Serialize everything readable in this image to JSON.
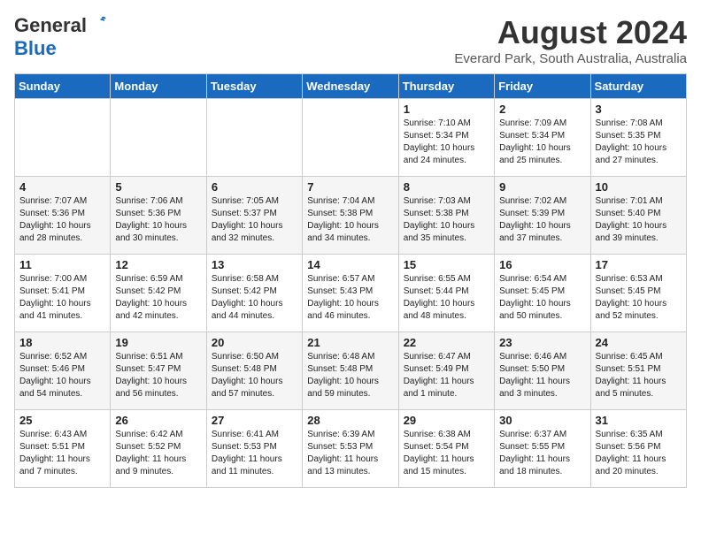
{
  "logo": {
    "general": "General",
    "blue": "Blue"
  },
  "title": "August 2024",
  "subtitle": "Everard Park, South Australia, Australia",
  "days_of_week": [
    "Sunday",
    "Monday",
    "Tuesday",
    "Wednesday",
    "Thursday",
    "Friday",
    "Saturday"
  ],
  "weeks": [
    [
      {
        "day": "",
        "info": ""
      },
      {
        "day": "",
        "info": ""
      },
      {
        "day": "",
        "info": ""
      },
      {
        "day": "",
        "info": ""
      },
      {
        "day": "1",
        "info": "Sunrise: 7:10 AM\nSunset: 5:34 PM\nDaylight: 10 hours\nand 24 minutes."
      },
      {
        "day": "2",
        "info": "Sunrise: 7:09 AM\nSunset: 5:34 PM\nDaylight: 10 hours\nand 25 minutes."
      },
      {
        "day": "3",
        "info": "Sunrise: 7:08 AM\nSunset: 5:35 PM\nDaylight: 10 hours\nand 27 minutes."
      }
    ],
    [
      {
        "day": "4",
        "info": "Sunrise: 7:07 AM\nSunset: 5:36 PM\nDaylight: 10 hours\nand 28 minutes."
      },
      {
        "day": "5",
        "info": "Sunrise: 7:06 AM\nSunset: 5:36 PM\nDaylight: 10 hours\nand 30 minutes."
      },
      {
        "day": "6",
        "info": "Sunrise: 7:05 AM\nSunset: 5:37 PM\nDaylight: 10 hours\nand 32 minutes."
      },
      {
        "day": "7",
        "info": "Sunrise: 7:04 AM\nSunset: 5:38 PM\nDaylight: 10 hours\nand 34 minutes."
      },
      {
        "day": "8",
        "info": "Sunrise: 7:03 AM\nSunset: 5:38 PM\nDaylight: 10 hours\nand 35 minutes."
      },
      {
        "day": "9",
        "info": "Sunrise: 7:02 AM\nSunset: 5:39 PM\nDaylight: 10 hours\nand 37 minutes."
      },
      {
        "day": "10",
        "info": "Sunrise: 7:01 AM\nSunset: 5:40 PM\nDaylight: 10 hours\nand 39 minutes."
      }
    ],
    [
      {
        "day": "11",
        "info": "Sunrise: 7:00 AM\nSunset: 5:41 PM\nDaylight: 10 hours\nand 41 minutes."
      },
      {
        "day": "12",
        "info": "Sunrise: 6:59 AM\nSunset: 5:42 PM\nDaylight: 10 hours\nand 42 minutes."
      },
      {
        "day": "13",
        "info": "Sunrise: 6:58 AM\nSunset: 5:42 PM\nDaylight: 10 hours\nand 44 minutes."
      },
      {
        "day": "14",
        "info": "Sunrise: 6:57 AM\nSunset: 5:43 PM\nDaylight: 10 hours\nand 46 minutes."
      },
      {
        "day": "15",
        "info": "Sunrise: 6:55 AM\nSunset: 5:44 PM\nDaylight: 10 hours\nand 48 minutes."
      },
      {
        "day": "16",
        "info": "Sunrise: 6:54 AM\nSunset: 5:45 PM\nDaylight: 10 hours\nand 50 minutes."
      },
      {
        "day": "17",
        "info": "Sunrise: 6:53 AM\nSunset: 5:45 PM\nDaylight: 10 hours\nand 52 minutes."
      }
    ],
    [
      {
        "day": "18",
        "info": "Sunrise: 6:52 AM\nSunset: 5:46 PM\nDaylight: 10 hours\nand 54 minutes."
      },
      {
        "day": "19",
        "info": "Sunrise: 6:51 AM\nSunset: 5:47 PM\nDaylight: 10 hours\nand 56 minutes."
      },
      {
        "day": "20",
        "info": "Sunrise: 6:50 AM\nSunset: 5:48 PM\nDaylight: 10 hours\nand 57 minutes."
      },
      {
        "day": "21",
        "info": "Sunrise: 6:48 AM\nSunset: 5:48 PM\nDaylight: 10 hours\nand 59 minutes."
      },
      {
        "day": "22",
        "info": "Sunrise: 6:47 AM\nSunset: 5:49 PM\nDaylight: 11 hours\nand 1 minute."
      },
      {
        "day": "23",
        "info": "Sunrise: 6:46 AM\nSunset: 5:50 PM\nDaylight: 11 hours\nand 3 minutes."
      },
      {
        "day": "24",
        "info": "Sunrise: 6:45 AM\nSunset: 5:51 PM\nDaylight: 11 hours\nand 5 minutes."
      }
    ],
    [
      {
        "day": "25",
        "info": "Sunrise: 6:43 AM\nSunset: 5:51 PM\nDaylight: 11 hours\nand 7 minutes."
      },
      {
        "day": "26",
        "info": "Sunrise: 6:42 AM\nSunset: 5:52 PM\nDaylight: 11 hours\nand 9 minutes."
      },
      {
        "day": "27",
        "info": "Sunrise: 6:41 AM\nSunset: 5:53 PM\nDaylight: 11 hours\nand 11 minutes."
      },
      {
        "day": "28",
        "info": "Sunrise: 6:39 AM\nSunset: 5:53 PM\nDaylight: 11 hours\nand 13 minutes."
      },
      {
        "day": "29",
        "info": "Sunrise: 6:38 AM\nSunset: 5:54 PM\nDaylight: 11 hours\nand 15 minutes."
      },
      {
        "day": "30",
        "info": "Sunrise: 6:37 AM\nSunset: 5:55 PM\nDaylight: 11 hours\nand 18 minutes."
      },
      {
        "day": "31",
        "info": "Sunrise: 6:35 AM\nSunset: 5:56 PM\nDaylight: 11 hours\nand 20 minutes."
      }
    ]
  ]
}
